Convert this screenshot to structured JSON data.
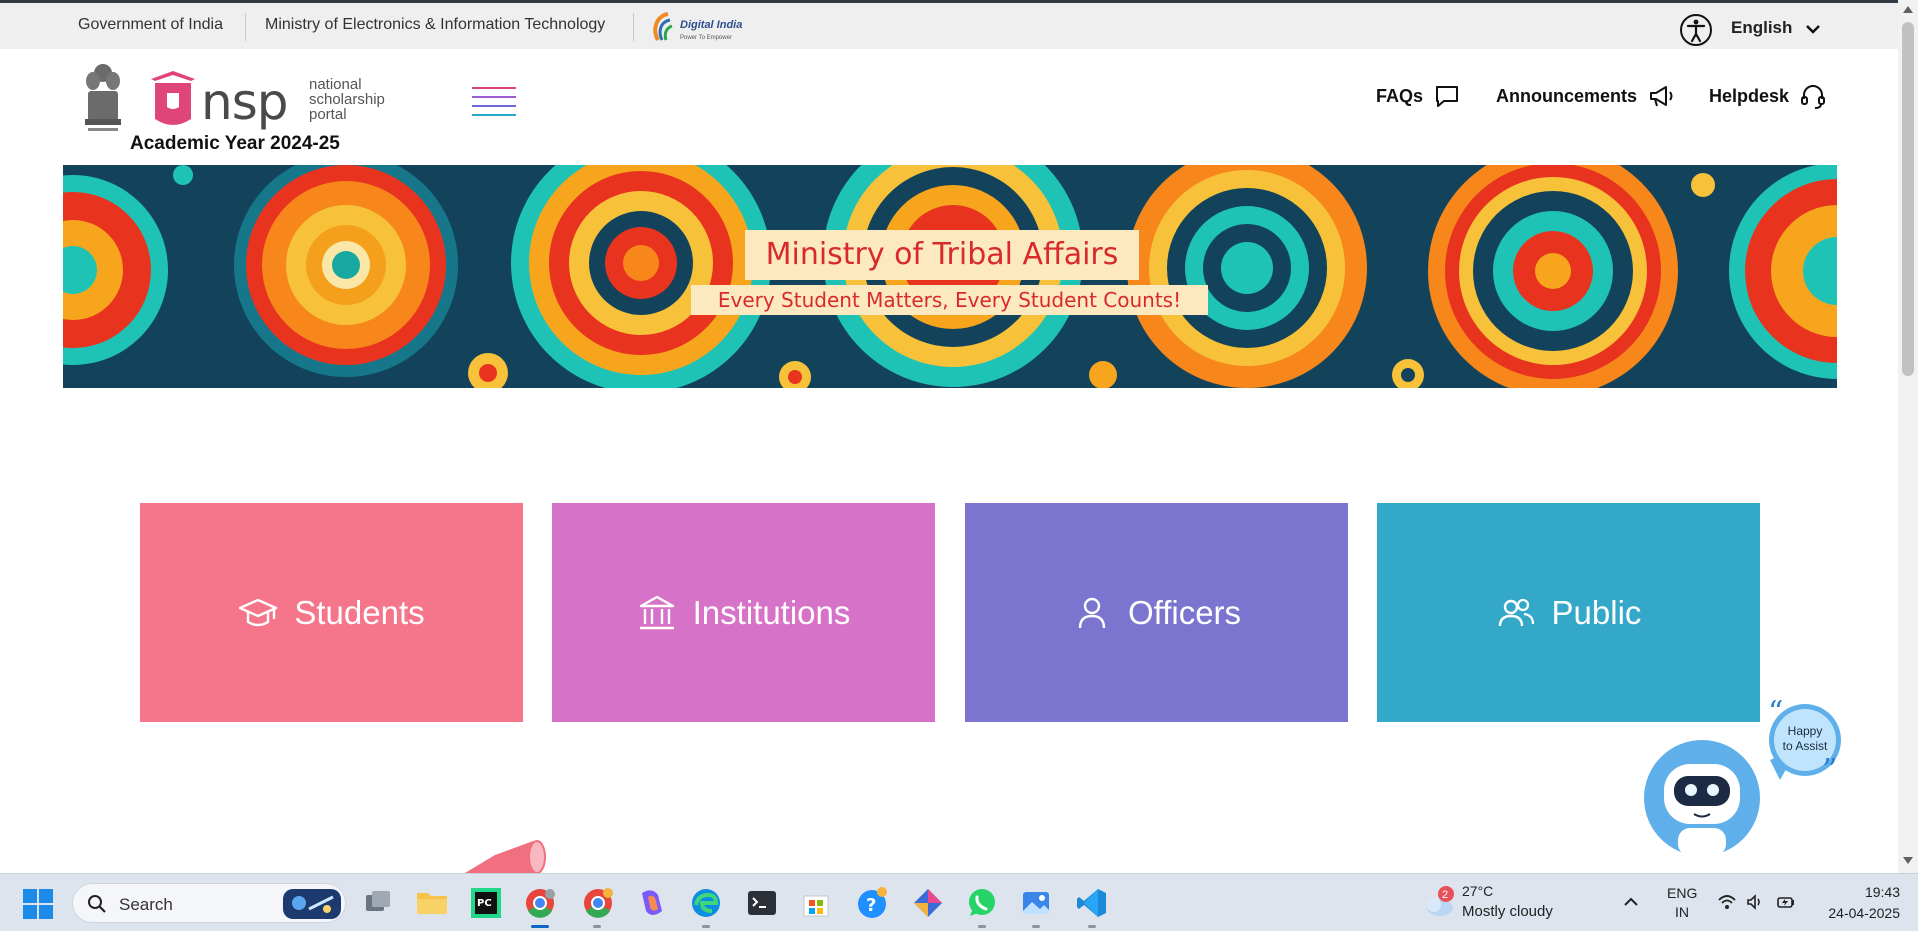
{
  "gov_bar": {
    "government": "Government of India",
    "ministry": "Ministry of Electronics & Information Technology",
    "digital_india": "Digital India",
    "digital_india_tagline": "Power To Empower",
    "language": "English"
  },
  "header": {
    "logo_text": "nsp",
    "logo_sub": [
      "national",
      "scholarship",
      "portal"
    ],
    "academic_year": "Academic Year 2024-25",
    "links": {
      "faqs": "FAQs",
      "announcements": "Announcements",
      "helpdesk": "Helpdesk"
    }
  },
  "banner": {
    "title": "Ministry of Tribal Affairs",
    "tagline": "Every Student Matters, Every Student Counts!"
  },
  "tiles": {
    "students": "Students",
    "institutions": "Institutions",
    "officers": "Officers",
    "public": "Public"
  },
  "assist_bot": {
    "bubble": "Happy to Assist"
  },
  "taskbar": {
    "search_label": "Search",
    "weather_badge": "2",
    "weather_temp": "27°C",
    "weather_desc": "Mostly cloudy",
    "lang_line1": "ENG",
    "lang_line2": "IN",
    "time": "19:43",
    "date": "24-04-2025",
    "apps": [
      "task-view",
      "file-explorer",
      "pycharm",
      "chrome",
      "chrome-profile",
      "copilot",
      "edge",
      "terminal",
      "microsoft-store",
      "get-help",
      "snipping-tool",
      "whatsapp",
      "photos",
      "vs-code"
    ]
  },
  "colors": {
    "students": "#f5758a",
    "institutions": "#d672c7",
    "officers": "#7c75d0",
    "public": "#33a8c8",
    "banner_text": "#d82a2a",
    "banner_label_bg": "#fde9c0"
  }
}
